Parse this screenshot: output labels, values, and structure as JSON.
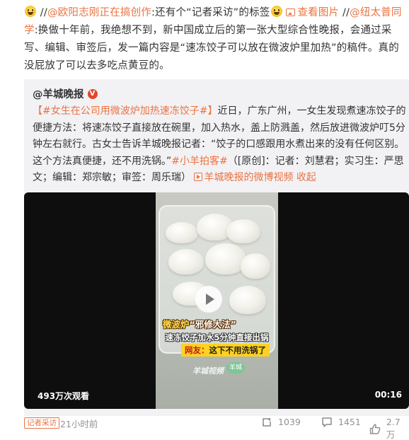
{
  "repost": {
    "user1": "@欧阳志刚正在搞创作",
    "colon1": ":还有个",
    "quoted": "“记者采访”",
    "text_after_quote": "的标签",
    "view_image": "查看图片",
    "separator": " //",
    "user2": "@纽太普同学",
    "body": ":换做十年前，我绝想不到，新中国成立后的第一张大型综合性晚报，会通过采写、编辑、审签后，发一篇内容是“速冻饺子可以放在微波炉里加热”的稿件。真的没屁放了可以去多吃点黄豆的。"
  },
  "original": {
    "author": "@羊城晚报",
    "verified_badge": "V",
    "hashtag1": "【#女生在公司用微波炉加热速冻饺子#】",
    "body1": "近日，广东广州，一女生发现煮速冻饺子的便捷方法：将速冻饺子直接放在碗里，加入热水，盖上防溅盖，然后放进微波炉叮5分钟左右就行。古女士告诉羊城晚报记者：“饺子的口感跟用水煮出来的没有任何区别。这个方法真便捷，还不用洗锅。”",
    "hashtag2": "#小羊拍客#",
    "body2": "（[原创]：记者：刘慧君；实习生：严思文；编辑：郑宗敏；审签：周乐瑞）",
    "video_link": "羊城晚报的微博视频",
    "collapse": "收起"
  },
  "video": {
    "caption_line1_a": "微波炉",
    "caption_line1_b": "“邪修大法”",
    "caption_line2": "速冻饺子加水5分钟直接出锅",
    "caption_line3_prefix": "网友：",
    "caption_line3": "这下不用洗锅了",
    "watermark1": "羊城视频",
    "watermark2": "羊城",
    "views": "493万次观看",
    "duration": "00:16"
  },
  "footer": {
    "tag": "记者采访",
    "time": "21小时前",
    "reposts": "1039",
    "comments": "1451",
    "likes": "2.7万"
  },
  "colors": {
    "accent": "#eb7340",
    "text": "#333333",
    "muted": "#939393",
    "quote_bg": "#f2f2f5"
  },
  "icons": [
    "laugh-emoji-icon",
    "image-icon",
    "verified-icon",
    "video-link-icon",
    "play-icon",
    "repost-icon",
    "comment-icon",
    "like-icon"
  ]
}
